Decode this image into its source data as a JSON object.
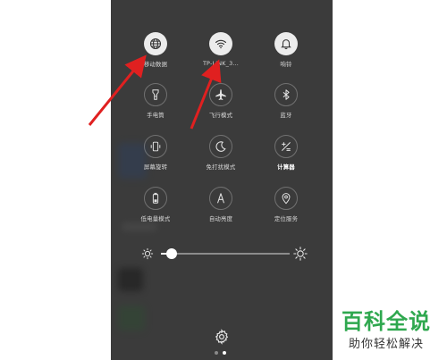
{
  "tiles": [
    {
      "label": "移动数据",
      "icon": "globe-icon",
      "on": true
    },
    {
      "label": "TP-LINK_3...",
      "icon": "wifi-icon",
      "on": true
    },
    {
      "label": "响铃",
      "icon": "bell-icon",
      "on": true
    },
    {
      "label": "手电筒",
      "icon": "flashlight-icon",
      "on": false
    },
    {
      "label": "飞行模式",
      "icon": "airplane-icon",
      "on": false
    },
    {
      "label": "蓝牙",
      "icon": "bluetooth-icon",
      "on": false
    },
    {
      "label": "屏幕旋转",
      "icon": "rotate-icon",
      "on": false
    },
    {
      "label": "免打扰模式",
      "icon": "moon-icon",
      "on": false
    },
    {
      "label": "计算器",
      "icon": "calculator-icon",
      "on": false
    },
    {
      "label": "低电量模式",
      "icon": "battery-icon",
      "on": false
    },
    {
      "label": "自动亮度",
      "icon": "auto-brightness-icon",
      "on": false
    },
    {
      "label": "定位服务",
      "icon": "location-icon",
      "on": false
    }
  ],
  "brightness": {
    "level": 0.08
  },
  "pager": {
    "pages": 2,
    "current": 1
  },
  "watermark": {
    "title": "百科全说",
    "subtitle": "助你轻松解决"
  },
  "colors": {
    "arrow": "#e02020",
    "watermark_green": "#2fa84f"
  }
}
